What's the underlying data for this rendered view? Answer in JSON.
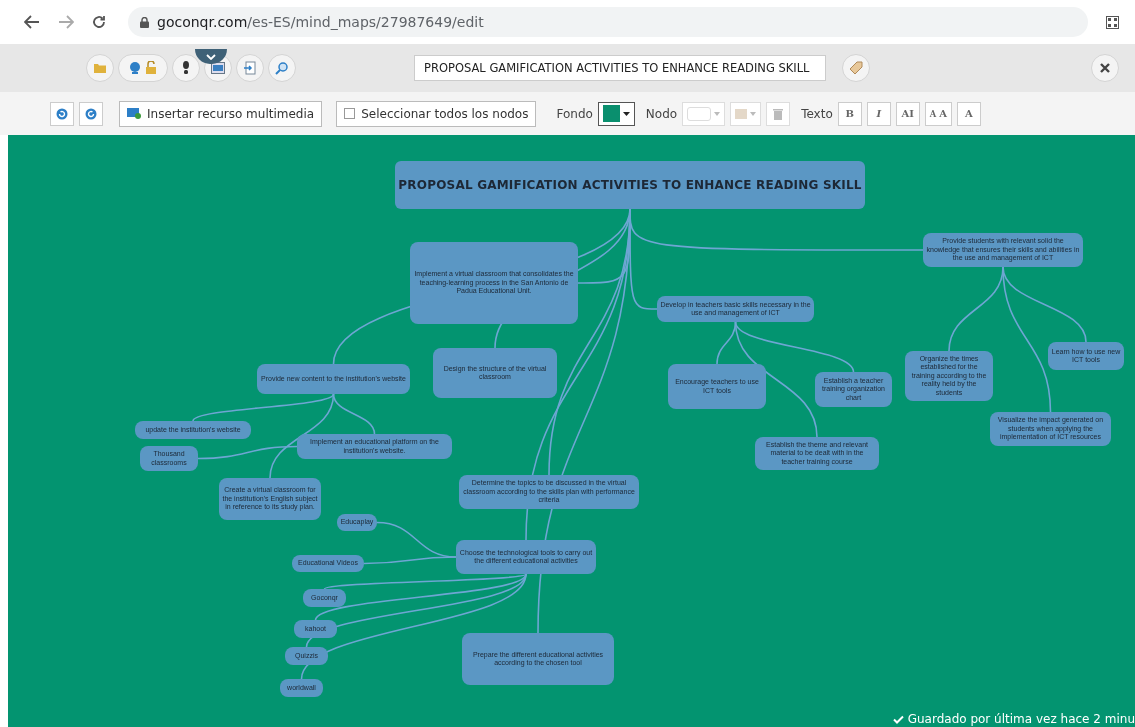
{
  "browser": {
    "url_host": "goconqr.com",
    "url_path": "/es-ES/mind_maps/27987649/edit"
  },
  "title_field": {
    "value": "PROPOSAL GAMIFICATION ACTIVITIES TO ENHANCE READING SKILL"
  },
  "toolbar": {
    "insert_button": "Insertar recurso multimedia",
    "select_all": {
      "label": "Seleccionar todos los nodos",
      "checked": false
    },
    "background_label": "Fondo",
    "node_label": "Nodo",
    "text_label": "Texto",
    "text_buttons": [
      "B",
      "I",
      "AI",
      "$^{A}$A",
      "A"
    ]
  },
  "mind_map": {
    "root": {
      "text": "PROPOSAL GAMIFICATION ACTIVITIES TO ENHANCE READING SKILL",
      "children": [
        {
          "text": "Implement a virtual classroom that consolidates the teaching-learning process in the San Antonio de Padua Educational Unit."
        },
        {
          "text": "Develop in teachers basic skills necessary in the use and management of ICT",
          "children": [
            {
              "text": "Encourage teachers to use ICT tools"
            },
            {
              "text": "Establish a teacher training organization chart"
            },
            {
              "text": "Establish the theme and relevant material to be dealt with in the teacher training course"
            }
          ]
        },
        {
          "text": "Provide students with relevant solid the knowledge that ensures their skills and abilities in the use and management of ICT",
          "children": [
            {
              "text": "Organize the times established for the training according to the reality held by the students"
            },
            {
              "text": "Visualize the impact generated on students when applying the implementation of ICT resources"
            },
            {
              "text": "Learn how to use new ICT tools"
            }
          ]
        },
        {
          "text": "Provide new content to the institution's website",
          "children": [
            {
              "text": "update the institution's website"
            },
            {
              "text": "Implement an educational platform on the institution's website.",
              "children": [
                {
                  "text": "Thousand classrooms"
                }
              ]
            },
            {
              "text": "Create a virtual classroom for the institution's English subject in reference to its study plan."
            }
          ]
        },
        {
          "text": "Design the structure of the virtual classroom"
        },
        {
          "text": "Determine the topics to be discussed in the virtual classroom according to the skills plan with performance criteria"
        },
        {
          "text": "Choose the technological tools to carry out the different educational activities",
          "children": [
            {
              "text": "Educaplay"
            },
            {
              "text": "Educational Videos"
            },
            {
              "text": "Goconqr"
            },
            {
              "text": "kahoot"
            },
            {
              "text": "Quizzis"
            },
            {
              "text": "worldwall"
            }
          ]
        },
        {
          "text": "Prepare the different educational activities according to the chosen tool"
        }
      ]
    }
  },
  "status": "Guardado por última vez hace 2 minu"
}
